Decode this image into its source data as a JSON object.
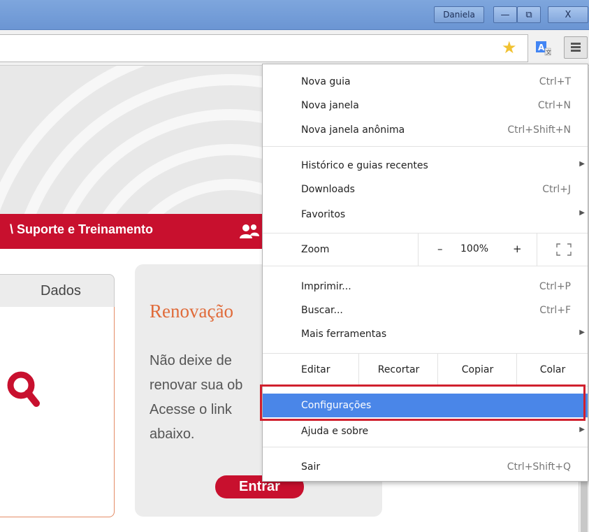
{
  "window": {
    "user_name": "Daniela",
    "minimize_label": "—",
    "maximize_label": "⧉",
    "close_label": "X"
  },
  "toolbar": {
    "bookmark_icon": "star-icon",
    "translate_icon": "translate-icon",
    "menu_icon": "hamburger-menu-icon"
  },
  "page": {
    "nav_label": "\\ Suporte e Treinamento",
    "tab_label": "Dados",
    "card": {
      "title": "Renovação",
      "text_lines": [
        "Não deixe de",
        "renovar sua ob",
        "Acesse o link",
        "abaixo."
      ],
      "button_label": "Entrar"
    },
    "colors": {
      "brand_red": "#c8102e",
      "title_orange": "#e06b3a",
      "menu_highlight": "#4a86e8"
    }
  },
  "menu": {
    "new_tab": {
      "label": "Nova guia",
      "shortcut": "Ctrl+T"
    },
    "new_window": {
      "label": "Nova janela",
      "shortcut": "Ctrl+N"
    },
    "incognito": {
      "label": "Nova janela anônima",
      "shortcut": "Ctrl+Shift+N"
    },
    "history": {
      "label": "Histórico e guias recentes"
    },
    "downloads": {
      "label": "Downloads",
      "shortcut": "Ctrl+J"
    },
    "bookmarks": {
      "label": "Favoritos"
    },
    "zoom": {
      "label": "Zoom",
      "minus": "–",
      "value": "100%",
      "plus": "+"
    },
    "print": {
      "label": "Imprimir...",
      "shortcut": "Ctrl+P"
    },
    "find": {
      "label": "Buscar...",
      "shortcut": "Ctrl+F"
    },
    "more_tools": {
      "label": "Mais ferramentas"
    },
    "edit": {
      "label": "Editar",
      "cut": "Recortar",
      "copy": "Copiar",
      "paste": "Colar"
    },
    "settings": {
      "label": "Configurações"
    },
    "help": {
      "label": "Ajuda e sobre"
    },
    "exit": {
      "label": "Sair",
      "shortcut": "Ctrl+Shift+Q"
    }
  }
}
